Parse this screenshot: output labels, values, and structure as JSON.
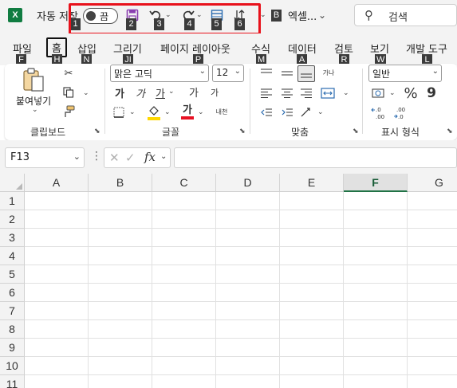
{
  "titlebar": {
    "logo": "X",
    "autosave_label": "자동 저장",
    "autosave_state": "끔",
    "doc_title": "엑셀...",
    "search_placeholder": "검색",
    "qat_keytips": [
      "1",
      "2",
      "3",
      "4",
      "5",
      "6"
    ],
    "more_keytip": "B",
    "icons": [
      "save-icon",
      "undo-icon",
      "redo-icon",
      "form-icon",
      "sort-icon"
    ]
  },
  "tabs": [
    {
      "label": "파일",
      "keytip": "F"
    },
    {
      "label": "홈",
      "keytip": "H",
      "active": true
    },
    {
      "label": "삽입",
      "keytip": "N"
    },
    {
      "label": "그리기",
      "keytip": "JI"
    },
    {
      "label": "페이지 레이아웃",
      "keytip": "P"
    },
    {
      "label": "수식",
      "keytip": "M"
    },
    {
      "label": "데이터",
      "keytip": "A"
    },
    {
      "label": "검토",
      "keytip": "R"
    },
    {
      "label": "보기",
      "keytip": "W"
    },
    {
      "label": "개발 도구",
      "keytip": "L"
    }
  ],
  "ribbon": {
    "clipboard": {
      "paste_label": "붙여넣기",
      "group_label": "클립보드"
    },
    "font": {
      "font_name": "맑은 고딕",
      "font_size": "12",
      "bold": "가",
      "italic": "가",
      "underline": "가",
      "grow": "가",
      "shrink": "가",
      "font_color": "가",
      "phonetic": "내천",
      "group_label": "글꼴"
    },
    "alignment": {
      "wrap_label": "가나",
      "group_label": "맞춤"
    },
    "number": {
      "format": "일반",
      "percent": "%",
      "comma": "9",
      "group_label": "표시 형식"
    },
    "colors": {
      "accent_green": "#217346",
      "font_color_bar": "#e81123",
      "fill_color_bar": "#ffd700"
    }
  },
  "formula_bar": {
    "name_box": "F13",
    "cancel": "✕",
    "enter": "✓",
    "fx": "fx",
    "value": ""
  },
  "grid": {
    "columns": [
      "A",
      "B",
      "C",
      "D",
      "E",
      "F",
      "G"
    ],
    "selected_column": "F",
    "rows": [
      "1",
      "2",
      "3",
      "4",
      "5",
      "6",
      "7",
      "8",
      "9",
      "10",
      "11"
    ]
  }
}
